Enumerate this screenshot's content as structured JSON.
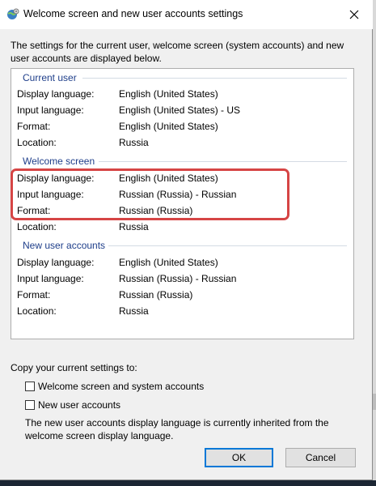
{
  "window": {
    "title": "Welcome screen and new user accounts settings",
    "intro": "The settings for the current user, welcome screen (system accounts) and new user accounts are displayed below."
  },
  "labels": {
    "display_language": "Display language:",
    "input_language": "Input language:",
    "format": "Format:",
    "location": "Location:"
  },
  "groups": [
    {
      "title": "Current user",
      "display_language": "English (United States)",
      "input_language": "English (United States) - US",
      "format": "English (United States)",
      "location": "Russia"
    },
    {
      "title": "Welcome screen",
      "display_language": "English (United States)",
      "input_language": "Russian (Russia) - Russian",
      "format": "Russian (Russia)",
      "location": "Russia"
    },
    {
      "title": "New user accounts",
      "display_language": "English (United States)",
      "input_language": "Russian (Russia) - Russian",
      "format": "Russian (Russia)",
      "location": "Russia"
    }
  ],
  "copy": {
    "label": "Copy your current settings to:",
    "welcome_checkbox": "Welcome screen and system accounts",
    "welcome_checked": false,
    "new_users_checkbox": "New user accounts",
    "new_users_checked": false,
    "note": "The new user accounts display language is currently inherited from the welcome screen display language."
  },
  "buttons": {
    "ok": "OK",
    "cancel": "Cancel"
  },
  "colors": {
    "group_title": "#1e3e8a",
    "highlight": "#d64545",
    "ok_focus": "#0078d7"
  }
}
